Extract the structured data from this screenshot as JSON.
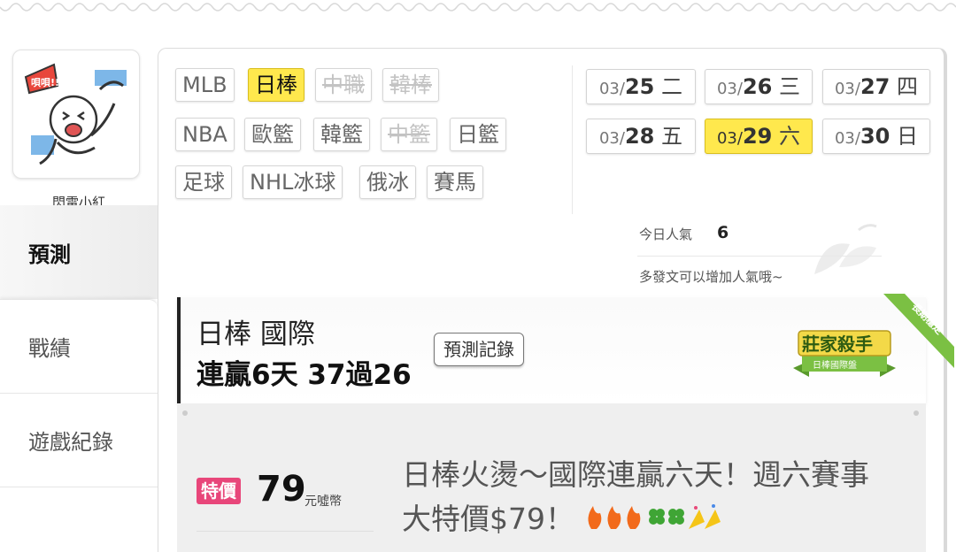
{
  "user": {
    "name": "閃電小紅",
    "avatar_text": "唄唄!!"
  },
  "sidebar": {
    "tabs": [
      {
        "label": "預測"
      },
      {
        "label": "戰績"
      },
      {
        "label": "遊戲紀錄"
      }
    ]
  },
  "leagues": {
    "row1": [
      "MLB",
      "日棒",
      "中職",
      "韓棒"
    ],
    "row2": [
      "NBA",
      "歐籃",
      "韓籃",
      "中籃",
      "日籃"
    ],
    "row3": [
      "足球",
      "NHL冰球",
      "俄冰",
      "賽馬"
    ],
    "selected": "日棒",
    "disabled": [
      "中職",
      "韓棒",
      "中籃"
    ]
  },
  "dates": [
    {
      "md": "03/",
      "d": "25",
      "w": "二"
    },
    {
      "md": "03/",
      "d": "26",
      "w": "三"
    },
    {
      "md": "03/",
      "d": "27",
      "w": "四"
    },
    {
      "md": "03/",
      "d": "28",
      "w": "五"
    },
    {
      "md": "03/",
      "d": "29",
      "w": "六",
      "selected": true
    },
    {
      "md": "03/",
      "d": "30",
      "w": "日"
    }
  ],
  "popularity": {
    "label": "今日人氣",
    "value": "6",
    "hint": "多發文可以增加人氣哦~"
  },
  "card": {
    "title": "日棒 國際",
    "streak": "連贏6天 37過26",
    "record_button": "預測記錄",
    "badge": {
      "main": "莊家殺手",
      "sub": "日棒國際盤",
      "ribbon": "長期穩定"
    }
  },
  "offer": {
    "tag": "特價",
    "price": "79",
    "unit": "元噓幣",
    "headline": "日棒火燙～國際連贏六天！週六賽事大特價$79！"
  },
  "colors": {
    "selected_bg": "#ffe84d",
    "price_tag": "#e8467a",
    "badge_green": "#6fb43a"
  }
}
